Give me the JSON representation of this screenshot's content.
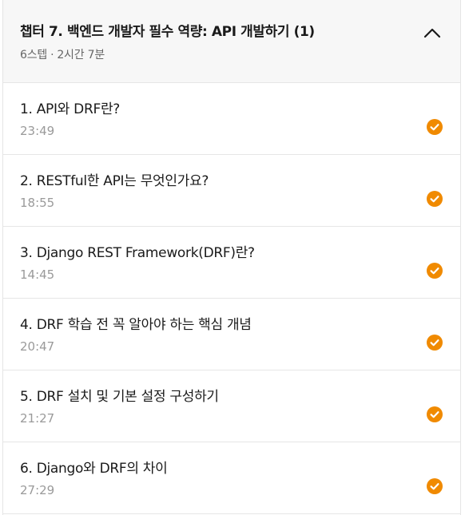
{
  "chapter": {
    "title": "챕터 7. 백엔드 개발자 필수 역량: API 개발하기 (1)",
    "steps": "6스텝",
    "separator": "·",
    "total_time": "2시간 7분",
    "expanded": true
  },
  "colors": {
    "accent": "#f08a00",
    "header_bg": "#f7f7f7",
    "divider": "#e6e6e6",
    "muted_text": "#9a9a9a"
  },
  "lessons": [
    {
      "title": "1. API와 DRF란?",
      "duration": "23:49",
      "completed": true,
      "icon": "check-circle-icon"
    },
    {
      "title": "2. RESTful한 API는 무엇인가요?",
      "duration": "18:55",
      "completed": true,
      "icon": "check-circle-icon"
    },
    {
      "title": "3. Django REST Framework(DRF)란?",
      "duration": "14:45",
      "completed": true,
      "icon": "check-circle-icon"
    },
    {
      "title": "4. DRF 학습 전 꼭 알아야 하는 핵심 개념",
      "duration": "20:47",
      "completed": true,
      "icon": "check-circle-icon"
    },
    {
      "title": "5. DRF 설치 및 기본 설정 구성하기",
      "duration": "21:27",
      "completed": true,
      "icon": "check-circle-icon"
    },
    {
      "title": "6. Django와 DRF의 차이",
      "duration": "27:29",
      "completed": true,
      "icon": "check-circle-icon"
    }
  ]
}
